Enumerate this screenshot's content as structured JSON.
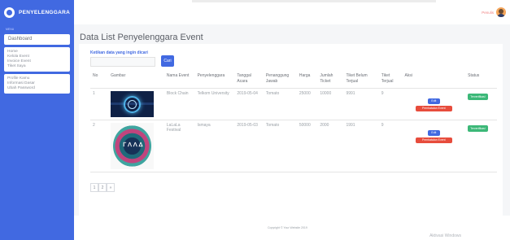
{
  "brand": {
    "name": "PENYELENGGARA"
  },
  "sidebar": {
    "heading": "MENU",
    "dashboard_label": "Dashboard",
    "group1": [
      "Home",
      "Kelola Event",
      "Invoice Event",
      "Tiket Saya"
    ],
    "group2": [
      "Profile Kamu",
      "Informasi Dasar",
      "Ubah Password"
    ]
  },
  "topbar": {
    "user_label": "Penulis"
  },
  "page": {
    "title": "Data List Penyelenggara Event"
  },
  "search": {
    "label": "Ketikan data yang ingin dicari",
    "placeholder": "",
    "button": "Cari"
  },
  "table": {
    "headers": [
      "No",
      "Gambar",
      "Nama Event",
      "Penyelenggara",
      "Tanggal Acara",
      "Penanggung Jawab",
      "Harga",
      "Jumlah Ticket",
      "Tiket Belum Terjual",
      "Tiket Terjual",
      "Aksi",
      "Status"
    ],
    "rows": [
      {
        "no": "1",
        "nama": "Block Chain",
        "penyelenggara": "Telkom University",
        "tanggal": "2019-05-04",
        "pj": "Tomato",
        "harga": "25000",
        "jumlah": "10000",
        "belum": "9991",
        "terjual": "9",
        "edit": "Edit",
        "cancel": "Pembatalan Event",
        "status": "Terverifikasi"
      },
      {
        "no": "2",
        "nama": "LaLaLa Festival",
        "penyelenggara": "Ismaya",
        "tanggal": "2019-05-03",
        "pj": "Tomato",
        "harga": "50000",
        "jumlah": "2000",
        "belum": "1991",
        "terjual": "9",
        "edit": "Edit",
        "cancel": "Pembatalan Event",
        "status": "Terverifikasi"
      }
    ]
  },
  "pagination": [
    "1",
    "2",
    "»"
  ],
  "poster_text": "ᒥᐱᐱᐃ",
  "footer": {
    "copyright": "Copyright © Your Website 2019"
  },
  "corner": {
    "text": "Aktivasi Windows"
  },
  "colors": {
    "primary": "#4169e1",
    "danger": "#e74c3c",
    "success": "#3cb878"
  }
}
